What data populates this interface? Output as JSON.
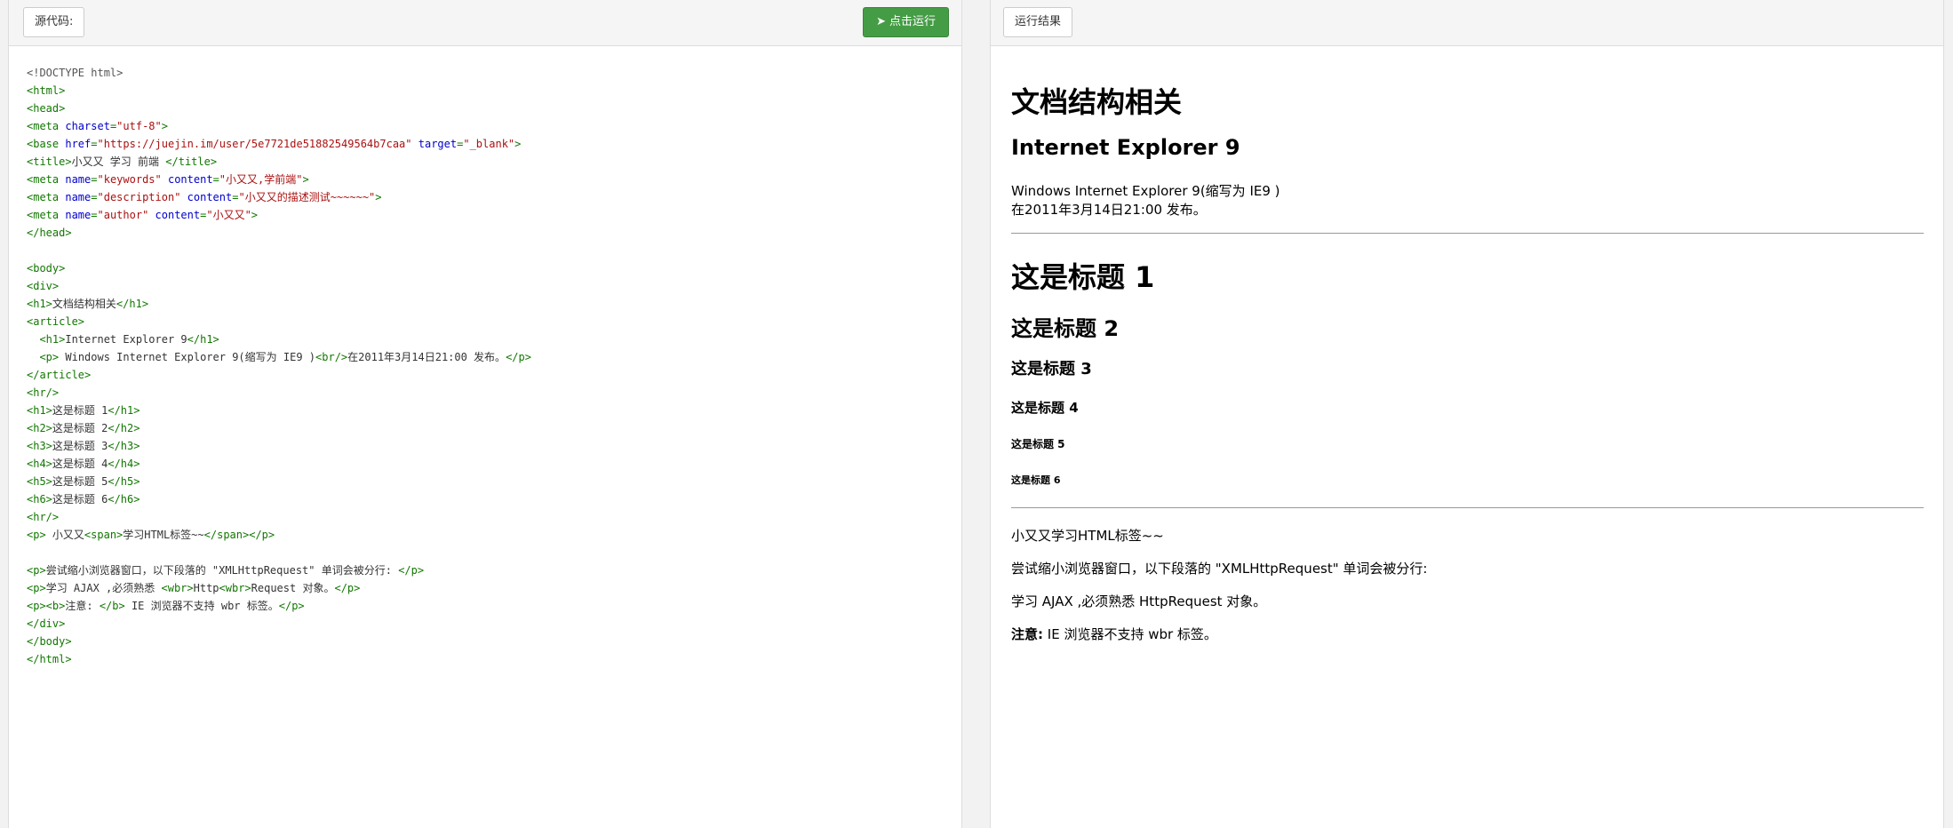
{
  "left_panel": {
    "source_label": "源代码:",
    "run_button": "点击运行",
    "code_lines": [
      [
        [
          "doc",
          "<!DOCTYPE html>"
        ]
      ],
      [
        [
          "tag",
          "<html>"
        ]
      ],
      [
        [
          "tag",
          "<head>"
        ]
      ],
      [
        [
          "tag",
          "<meta "
        ],
        [
          "attr",
          "charset"
        ],
        [
          "tag",
          "="
        ],
        [
          "str",
          "\"utf-8\""
        ],
        [
          "tag",
          ">"
        ]
      ],
      [
        [
          "tag",
          "<base "
        ],
        [
          "attr",
          "href"
        ],
        [
          "tag",
          "="
        ],
        [
          "str",
          "\"https://juejin.im/user/5e7721de51882549564b7caa\""
        ],
        [
          "txt",
          " "
        ],
        [
          "attr",
          "target"
        ],
        [
          "tag",
          "="
        ],
        [
          "str",
          "\"_blank\""
        ],
        [
          "tag",
          ">"
        ]
      ],
      [
        [
          "tag",
          "<title>"
        ],
        [
          "txt",
          "小又又 学习 前端 "
        ],
        [
          "tag",
          "</title>"
        ]
      ],
      [
        [
          "tag",
          "<meta "
        ],
        [
          "attr",
          "name"
        ],
        [
          "tag",
          "="
        ],
        [
          "str",
          "\"keywords\""
        ],
        [
          "txt",
          " "
        ],
        [
          "attr",
          "content"
        ],
        [
          "tag",
          "="
        ],
        [
          "str",
          "\"小又又,学前端\""
        ],
        [
          "tag",
          ">"
        ]
      ],
      [
        [
          "tag",
          "<meta "
        ],
        [
          "attr",
          "name"
        ],
        [
          "tag",
          "="
        ],
        [
          "str",
          "\"description\""
        ],
        [
          "txt",
          " "
        ],
        [
          "attr",
          "content"
        ],
        [
          "tag",
          "="
        ],
        [
          "str",
          "\"小又又的描述测试~~~~~~\""
        ],
        [
          "tag",
          ">"
        ]
      ],
      [
        [
          "tag",
          "<meta "
        ],
        [
          "attr",
          "name"
        ],
        [
          "tag",
          "="
        ],
        [
          "str",
          "\"author\""
        ],
        [
          "txt",
          " "
        ],
        [
          "attr",
          "content"
        ],
        [
          "tag",
          "="
        ],
        [
          "str",
          "\"小又又\""
        ],
        [
          "tag",
          ">"
        ]
      ],
      [
        [
          "tag",
          "</head>"
        ]
      ],
      [],
      [
        [
          "tag",
          "<body>"
        ]
      ],
      [
        [
          "tag",
          "<div>"
        ]
      ],
      [
        [
          "tag",
          "<h1>"
        ],
        [
          "txt",
          "文档结构相关"
        ],
        [
          "tag",
          "</h1>"
        ]
      ],
      [
        [
          "tag",
          "<article>"
        ]
      ],
      [
        [
          "txt",
          "  "
        ],
        [
          "tag",
          "<h1>"
        ],
        [
          "txt",
          "Internet Explorer 9"
        ],
        [
          "tag",
          "</h1>"
        ]
      ],
      [
        [
          "txt",
          "  "
        ],
        [
          "tag",
          "<p>"
        ],
        [
          "txt",
          " Windows Internet Explorer 9(缩写为 IE9 )"
        ],
        [
          "tag",
          "<br/>"
        ],
        [
          "txt",
          "在2011年3月14日21:00 发布。"
        ],
        [
          "tag",
          "</p>"
        ]
      ],
      [
        [
          "tag",
          "</article>"
        ]
      ],
      [
        [
          "tag",
          "<hr/>"
        ]
      ],
      [
        [
          "tag",
          "<h1>"
        ],
        [
          "txt",
          "这是标题 1"
        ],
        [
          "tag",
          "</h1>"
        ]
      ],
      [
        [
          "tag",
          "<h2>"
        ],
        [
          "txt",
          "这是标题 2"
        ],
        [
          "tag",
          "</h2>"
        ]
      ],
      [
        [
          "tag",
          "<h3>"
        ],
        [
          "txt",
          "这是标题 3"
        ],
        [
          "tag",
          "</h3>"
        ]
      ],
      [
        [
          "tag",
          "<h4>"
        ],
        [
          "txt",
          "这是标题 4"
        ],
        [
          "tag",
          "</h4>"
        ]
      ],
      [
        [
          "tag",
          "<h5>"
        ],
        [
          "txt",
          "这是标题 5"
        ],
        [
          "tag",
          "</h5>"
        ]
      ],
      [
        [
          "tag",
          "<h6>"
        ],
        [
          "txt",
          "这是标题 6"
        ],
        [
          "tag",
          "</h6>"
        ]
      ],
      [
        [
          "tag",
          "<hr/>"
        ]
      ],
      [
        [
          "tag",
          "<p>"
        ],
        [
          "txt",
          " 小又又"
        ],
        [
          "tag",
          "<span>"
        ],
        [
          "txt",
          "学习HTML标签~~"
        ],
        [
          "tag",
          "</span></p>"
        ]
      ],
      [],
      [
        [
          "tag",
          "<p>"
        ],
        [
          "txt",
          "尝试缩小浏览器窗口，以下段落的 \"XMLHttpRequest\" 单词会被分行: "
        ],
        [
          "tag",
          "</p>"
        ]
      ],
      [
        [
          "tag",
          "<p>"
        ],
        [
          "txt",
          "学习 AJAX ,必须熟悉 "
        ],
        [
          "tag",
          "<wbr>"
        ],
        [
          "txt",
          "Http"
        ],
        [
          "tag",
          "<wbr>"
        ],
        [
          "txt",
          "Request 对象。"
        ],
        [
          "tag",
          "</p>"
        ]
      ],
      [
        [
          "tag",
          "<p><b>"
        ],
        [
          "txt",
          "注意: "
        ],
        [
          "tag",
          "</b>"
        ],
        [
          "txt",
          " IE 浏览器不支持 wbr 标签。"
        ],
        [
          "tag",
          "</p>"
        ]
      ],
      [
        [
          "tag",
          "</div>"
        ]
      ],
      [
        [
          "tag",
          "</body>"
        ]
      ],
      [
        [
          "tag",
          "</html>"
        ]
      ]
    ]
  },
  "right_panel": {
    "result_label": "运行结果",
    "preview": {
      "h1_title": "文档结构相关",
      "article_h1": "Internet Explorer 9",
      "article_p_line1": "Windows Internet Explorer 9(缩写为 IE9 )",
      "article_p_line2": "在2011年3月14日21:00 发布。",
      "heading1": "这是标题 1",
      "heading2": "这是标题 2",
      "heading3": "这是标题 3",
      "heading4": "这是标题 4",
      "heading5": "这是标题 5",
      "heading6": "这是标题 6",
      "span_para": "小又又学习HTML标签~~",
      "wbr_intro": "尝试缩小浏览器窗口，以下段落的 \"XMLHttpRequest\" 单词会被分行:",
      "wbr_para": "学习 AJAX ,必须熟悉 HttpRequest 对象。",
      "note_bold": "注意:",
      "note_text": " IE 浏览器不支持 wbr 标签。"
    }
  },
  "colors": {
    "run_button_bg": "#449d44",
    "tag": "#117700",
    "attr": "#0000cc",
    "string": "#aa1111"
  }
}
